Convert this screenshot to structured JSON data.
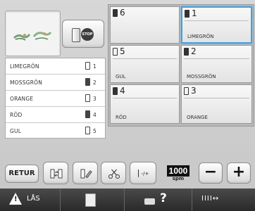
{
  "threads": [
    {
      "name": "LIMEGRÖN",
      "num": "1"
    },
    {
      "name": "MOSSGRÖN",
      "num": "2"
    },
    {
      "name": "ORANGE",
      "num": "3"
    },
    {
      "name": "RÖD",
      "num": "4"
    },
    {
      "name": "GUL",
      "num": "5"
    }
  ],
  "needles": [
    {
      "num": "6",
      "name": ""
    },
    {
      "num": "1",
      "name": "LIMEGRÖN"
    },
    {
      "num": "5",
      "name": "GUL"
    },
    {
      "num": "2",
      "name": "MOSSGRÖN"
    },
    {
      "num": "4",
      "name": "RÖD"
    },
    {
      "num": "3",
      "name": "ORANGE"
    }
  ],
  "toolbar": {
    "retur_label": "RETUR",
    "tension_label": "-/+",
    "speed_value": "1000",
    "speed_unit": "spm",
    "minus_label": "−",
    "plus_label": "+"
  },
  "status": {
    "lock_label": "LÅS",
    "help_label": "?",
    "settings_label": "IIII↔"
  },
  "colors": {
    "accent": "#4a9fd8",
    "statusbar": "#333333"
  }
}
